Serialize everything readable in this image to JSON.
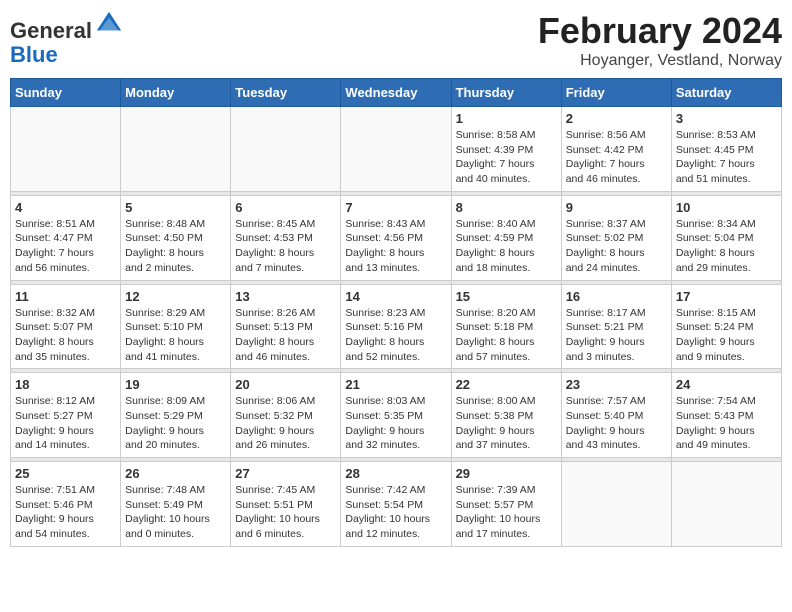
{
  "header": {
    "logo_line1": "General",
    "logo_line2": "Blue",
    "main_title": "February 2024",
    "subtitle": "Hoyanger, Vestland, Norway"
  },
  "weekdays": [
    "Sunday",
    "Monday",
    "Tuesday",
    "Wednesday",
    "Thursday",
    "Friday",
    "Saturday"
  ],
  "weeks": [
    [
      {
        "day": "",
        "info": ""
      },
      {
        "day": "",
        "info": ""
      },
      {
        "day": "",
        "info": ""
      },
      {
        "day": "",
        "info": ""
      },
      {
        "day": "1",
        "info": "Sunrise: 8:58 AM\nSunset: 4:39 PM\nDaylight: 7 hours\nand 40 minutes."
      },
      {
        "day": "2",
        "info": "Sunrise: 8:56 AM\nSunset: 4:42 PM\nDaylight: 7 hours\nand 46 minutes."
      },
      {
        "day": "3",
        "info": "Sunrise: 8:53 AM\nSunset: 4:45 PM\nDaylight: 7 hours\nand 51 minutes."
      }
    ],
    [
      {
        "day": "4",
        "info": "Sunrise: 8:51 AM\nSunset: 4:47 PM\nDaylight: 7 hours\nand 56 minutes."
      },
      {
        "day": "5",
        "info": "Sunrise: 8:48 AM\nSunset: 4:50 PM\nDaylight: 8 hours\nand 2 minutes."
      },
      {
        "day": "6",
        "info": "Sunrise: 8:45 AM\nSunset: 4:53 PM\nDaylight: 8 hours\nand 7 minutes."
      },
      {
        "day": "7",
        "info": "Sunrise: 8:43 AM\nSunset: 4:56 PM\nDaylight: 8 hours\nand 13 minutes."
      },
      {
        "day": "8",
        "info": "Sunrise: 8:40 AM\nSunset: 4:59 PM\nDaylight: 8 hours\nand 18 minutes."
      },
      {
        "day": "9",
        "info": "Sunrise: 8:37 AM\nSunset: 5:02 PM\nDaylight: 8 hours\nand 24 minutes."
      },
      {
        "day": "10",
        "info": "Sunrise: 8:34 AM\nSunset: 5:04 PM\nDaylight: 8 hours\nand 29 minutes."
      }
    ],
    [
      {
        "day": "11",
        "info": "Sunrise: 8:32 AM\nSunset: 5:07 PM\nDaylight: 8 hours\nand 35 minutes."
      },
      {
        "day": "12",
        "info": "Sunrise: 8:29 AM\nSunset: 5:10 PM\nDaylight: 8 hours\nand 41 minutes."
      },
      {
        "day": "13",
        "info": "Sunrise: 8:26 AM\nSunset: 5:13 PM\nDaylight: 8 hours\nand 46 minutes."
      },
      {
        "day": "14",
        "info": "Sunrise: 8:23 AM\nSunset: 5:16 PM\nDaylight: 8 hours\nand 52 minutes."
      },
      {
        "day": "15",
        "info": "Sunrise: 8:20 AM\nSunset: 5:18 PM\nDaylight: 8 hours\nand 57 minutes."
      },
      {
        "day": "16",
        "info": "Sunrise: 8:17 AM\nSunset: 5:21 PM\nDaylight: 9 hours\nand 3 minutes."
      },
      {
        "day": "17",
        "info": "Sunrise: 8:15 AM\nSunset: 5:24 PM\nDaylight: 9 hours\nand 9 minutes."
      }
    ],
    [
      {
        "day": "18",
        "info": "Sunrise: 8:12 AM\nSunset: 5:27 PM\nDaylight: 9 hours\nand 14 minutes."
      },
      {
        "day": "19",
        "info": "Sunrise: 8:09 AM\nSunset: 5:29 PM\nDaylight: 9 hours\nand 20 minutes."
      },
      {
        "day": "20",
        "info": "Sunrise: 8:06 AM\nSunset: 5:32 PM\nDaylight: 9 hours\nand 26 minutes."
      },
      {
        "day": "21",
        "info": "Sunrise: 8:03 AM\nSunset: 5:35 PM\nDaylight: 9 hours\nand 32 minutes."
      },
      {
        "day": "22",
        "info": "Sunrise: 8:00 AM\nSunset: 5:38 PM\nDaylight: 9 hours\nand 37 minutes."
      },
      {
        "day": "23",
        "info": "Sunrise: 7:57 AM\nSunset: 5:40 PM\nDaylight: 9 hours\nand 43 minutes."
      },
      {
        "day": "24",
        "info": "Sunrise: 7:54 AM\nSunset: 5:43 PM\nDaylight: 9 hours\nand 49 minutes."
      }
    ],
    [
      {
        "day": "25",
        "info": "Sunrise: 7:51 AM\nSunset: 5:46 PM\nDaylight: 9 hours\nand 54 minutes."
      },
      {
        "day": "26",
        "info": "Sunrise: 7:48 AM\nSunset: 5:49 PM\nDaylight: 10 hours\nand 0 minutes."
      },
      {
        "day": "27",
        "info": "Sunrise: 7:45 AM\nSunset: 5:51 PM\nDaylight: 10 hours\nand 6 minutes."
      },
      {
        "day": "28",
        "info": "Sunrise: 7:42 AM\nSunset: 5:54 PM\nDaylight: 10 hours\nand 12 minutes."
      },
      {
        "day": "29",
        "info": "Sunrise: 7:39 AM\nSunset: 5:57 PM\nDaylight: 10 hours\nand 17 minutes."
      },
      {
        "day": "",
        "info": ""
      },
      {
        "day": "",
        "info": ""
      }
    ]
  ]
}
